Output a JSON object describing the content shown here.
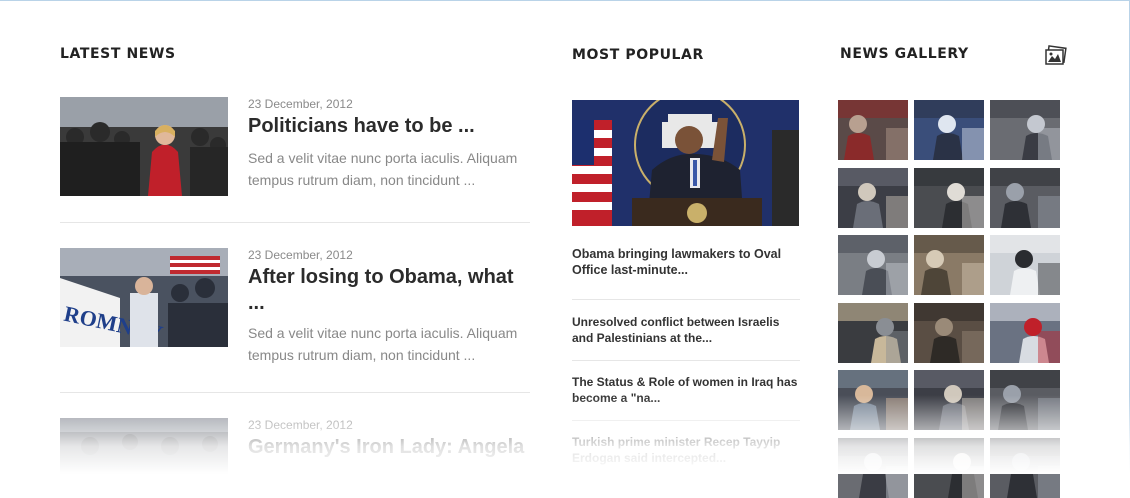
{
  "latest_news": {
    "heading": "LATEST NEWS",
    "items": [
      {
        "date": "23 December, 2012",
        "title": "Politicians have to be ...",
        "text": "Sed a velit vitae nunc porta iaculis. Aliquam tempus rutrum diam, non tincidunt ..."
      },
      {
        "date": "23 December, 2012",
        "title": "After losing to Obama, what ...",
        "text": "Sed a velit vitae nunc porta iaculis. Aliquam tempus rutrum diam, non tincidunt ..."
      },
      {
        "date": "23 December, 2012",
        "title": "Germany's Iron Lady: Angela",
        "text": ""
      }
    ]
  },
  "most_popular": {
    "heading": "MOST POPULAR",
    "items": [
      "Obama bringing lawmakers to Oval Office last-minute...",
      "Unresolved conflict between Israelis and Palestinians at the...",
      "The Status & Role of women in Iraq has become a \"na...",
      "Turkish prime minister Recep Tayyip Erdogan said intercepted..."
    ]
  },
  "news_gallery": {
    "heading": "NEWS GALLERY",
    "icon": "gallery-icon",
    "rows": 6,
    "cols": 3
  },
  "colors": {
    "title": "#2b2b2b",
    "date": "#8a8a8a",
    "excerpt": "#888888",
    "divider": "#e6e6e6",
    "frame": "#b9d3e8"
  }
}
